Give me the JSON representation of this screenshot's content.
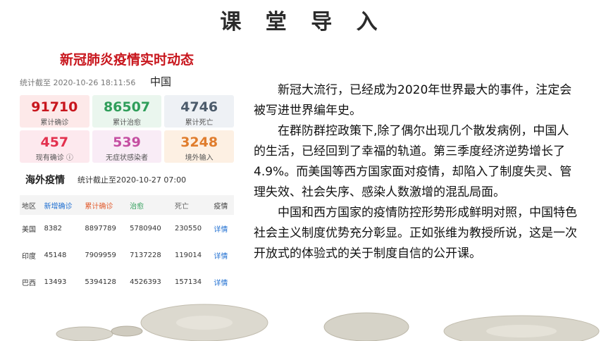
{
  "slide_title": "课 堂 导 入",
  "panel": {
    "title": "新冠肺炎疫情实时动态",
    "stat_time": "统计截至 2020-10-26 18:11:56",
    "region": "中国",
    "stats": [
      {
        "value": "91710",
        "label": "累计确诊",
        "color": "#c8161d",
        "bg": "#fde9e9"
      },
      {
        "value": "86507",
        "label": "累计治愈",
        "color": "#2f9e5a",
        "bg": "#eaf6ee"
      },
      {
        "value": "4746",
        "label": "累计死亡",
        "color": "#4c5b6b",
        "bg": "#eef1f5"
      },
      {
        "value": "457",
        "label": "现有确诊 ⓘ",
        "color": "#e3314e",
        "bg": "#fde9ee"
      },
      {
        "value": "539",
        "label": "无症状感染者",
        "color": "#c54fa2",
        "bg": "#f9ecf6"
      },
      {
        "value": "3248",
        "label": "境外输入",
        "color": "#e07d2d",
        "bg": "#fdf0e3"
      }
    ],
    "overseas_title": "海外疫情",
    "overseas_time": "统计截止至2020-10-27 07:00",
    "table": {
      "headers": [
        "地区",
        "新增确诊",
        "累计确诊",
        "治愈",
        "死亡",
        "疫情"
      ],
      "header_colors": [
        "#444",
        "#1f6fd1",
        "#e25b2d",
        "#2f9e5a",
        "#666",
        "#444"
      ],
      "rows": [
        [
          "美国",
          "8382",
          "8897789",
          "5780940",
          "230550",
          "详情"
        ],
        [
          "印度",
          "45148",
          "7909959",
          "7137228",
          "119014",
          "详情"
        ],
        [
          "巴西",
          "13493",
          "5394128",
          "4526393",
          "157134",
          "详情"
        ]
      ]
    }
  },
  "paragraphs": [
    "新冠大流行，已经成为2020年世界最大的事件，注定会被写进世界编年史。",
    "在群防群控政策下,除了偶尔出现几个散发病例，中国人的生活，已经回到了幸福的轨道。第三季度经济逆势增长了4.9%。而美国等西方国家面对疫情，却陷入了制度失灵、管理失效、社会失序、感染人数激增的混乱局面。",
    "中国和西方国家的疫情防控形势形成鲜明对照，中国特色社会主义制度优势充分彰显。正如张维为教授所说，这是一次开放式的体验式的关于制度自信的公开课。"
  ]
}
